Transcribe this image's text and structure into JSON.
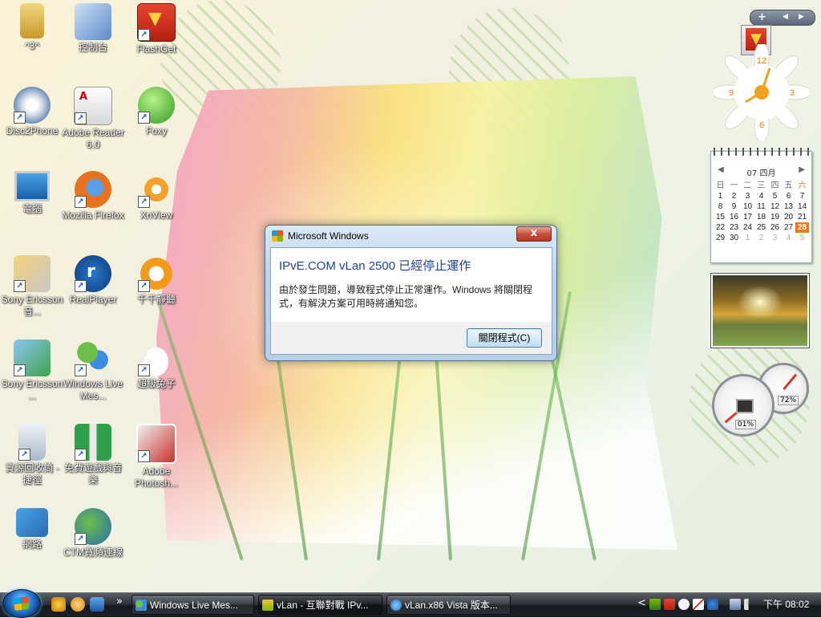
{
  "desktop": {
    "icons": [
      {
        "label": "^3^",
        "icon": "folder-icon"
      },
      {
        "label": "控制台",
        "icon": "control-panel-icon"
      },
      {
        "label": "FlashGet",
        "icon": "flashget-icon"
      },
      {
        "label": "Disc2Phone",
        "icon": "disc2phone-icon"
      },
      {
        "label": "Adobe Reader 6.0",
        "icon": "adobe-reader-icon"
      },
      {
        "label": "Foxy",
        "icon": "foxy-icon"
      },
      {
        "label": "電腦",
        "icon": "computer-icon"
      },
      {
        "label": "Mozilla Firefox",
        "icon": "firefox-icon"
      },
      {
        "label": "XnView",
        "icon": "xnview-icon"
      },
      {
        "label": "Sony Ericsson 音...",
        "icon": "sony-ericsson-phone-icon"
      },
      {
        "label": "RealPlayer",
        "icon": "realplayer-icon"
      },
      {
        "label": "千千靜聽",
        "icon": "ttplayer-icon"
      },
      {
        "label": "Sony Ericsson ...",
        "icon": "sony-ericsson-sync-icon"
      },
      {
        "label": "Windows Live Mes...",
        "icon": "messenger-icon"
      },
      {
        "label": "超級兔子",
        "icon": "rabbit-icon"
      },
      {
        "label": "資源回收筒 - 捷徑",
        "icon": "recycle-bin-icon"
      },
      {
        "label": "免費遊戲與音樂",
        "icon": "gift-icon"
      },
      {
        "label": "Adobe Photosh...",
        "icon": "photoshop-icon"
      },
      {
        "label": "網路",
        "icon": "network-icon"
      },
      {
        "label": "CTM寬頻連線",
        "icon": "broadband-icon"
      }
    ]
  },
  "dialog": {
    "title": "Microsoft Windows",
    "close": "x",
    "heading": "IPvE.COM vLan 2500 已經停止運作",
    "message": "由於發生問題，導致程式停止正常運作。Windows 將關閉程式，有解決方案可用時將通知您。",
    "button": "關閉程式(C)"
  },
  "sidebar": {
    "add": "+",
    "prev": "◀",
    "next": "▶",
    "clock_numbers": [
      "12",
      "3",
      "6",
      "9"
    ],
    "calendar": {
      "month": "07 四月",
      "weekdays": [
        "日",
        "一",
        "二",
        "三",
        "四",
        "五",
        "六"
      ],
      "weeks": [
        [
          "1",
          "2",
          "3",
          "4",
          "5",
          "6",
          "7"
        ],
        [
          "8",
          "9",
          "10",
          "11",
          "12",
          "13",
          "14"
        ],
        [
          "15",
          "16",
          "17",
          "18",
          "19",
          "20",
          "21"
        ],
        [
          "22",
          "23",
          "24",
          "25",
          "26",
          "27",
          "28"
        ],
        [
          "29",
          "30",
          "1",
          "2",
          "3",
          "4",
          "5"
        ]
      ],
      "today": "28"
    },
    "meters": {
      "cpu": "01%",
      "memory": "72%"
    }
  },
  "taskbar": {
    "tasks": [
      {
        "label": "Windows Live Mes...",
        "active": false
      },
      {
        "label": "vLan - 互聯對戰 IPv...",
        "active": true
      },
      {
        "label": "vLan.x86 Vista 版本...",
        "active": false
      }
    ],
    "overflow": "»",
    "tray_expand": "<",
    "time": "下午 08:02"
  },
  "colors": {
    "dialog_heading": "#1e3f9c",
    "today": "#e8791c"
  }
}
